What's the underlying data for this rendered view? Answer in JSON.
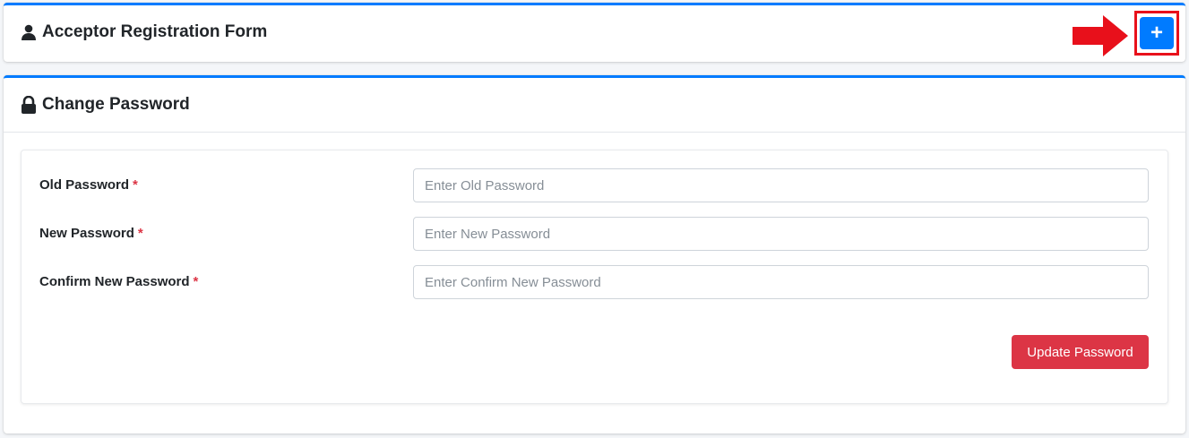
{
  "registration_card": {
    "title": "Acceptor Registration Form",
    "add_button_label": "+",
    "icon": "user-icon"
  },
  "password_card": {
    "title": "Change Password",
    "icon": "lock-icon",
    "fields": [
      {
        "label": "Old Password",
        "required_mark": "*",
        "placeholder": "Enter Old Password",
        "value": ""
      },
      {
        "label": "New Password",
        "required_mark": "*",
        "placeholder": "Enter New Password",
        "value": ""
      },
      {
        "label": "Confirm New Password",
        "required_mark": "*",
        "placeholder": "Enter Confirm New Password",
        "value": ""
      }
    ],
    "submit_label": "Update Password"
  },
  "colors": {
    "primary": "#007bff",
    "danger": "#dc3545",
    "annotation": "#e8101b"
  }
}
